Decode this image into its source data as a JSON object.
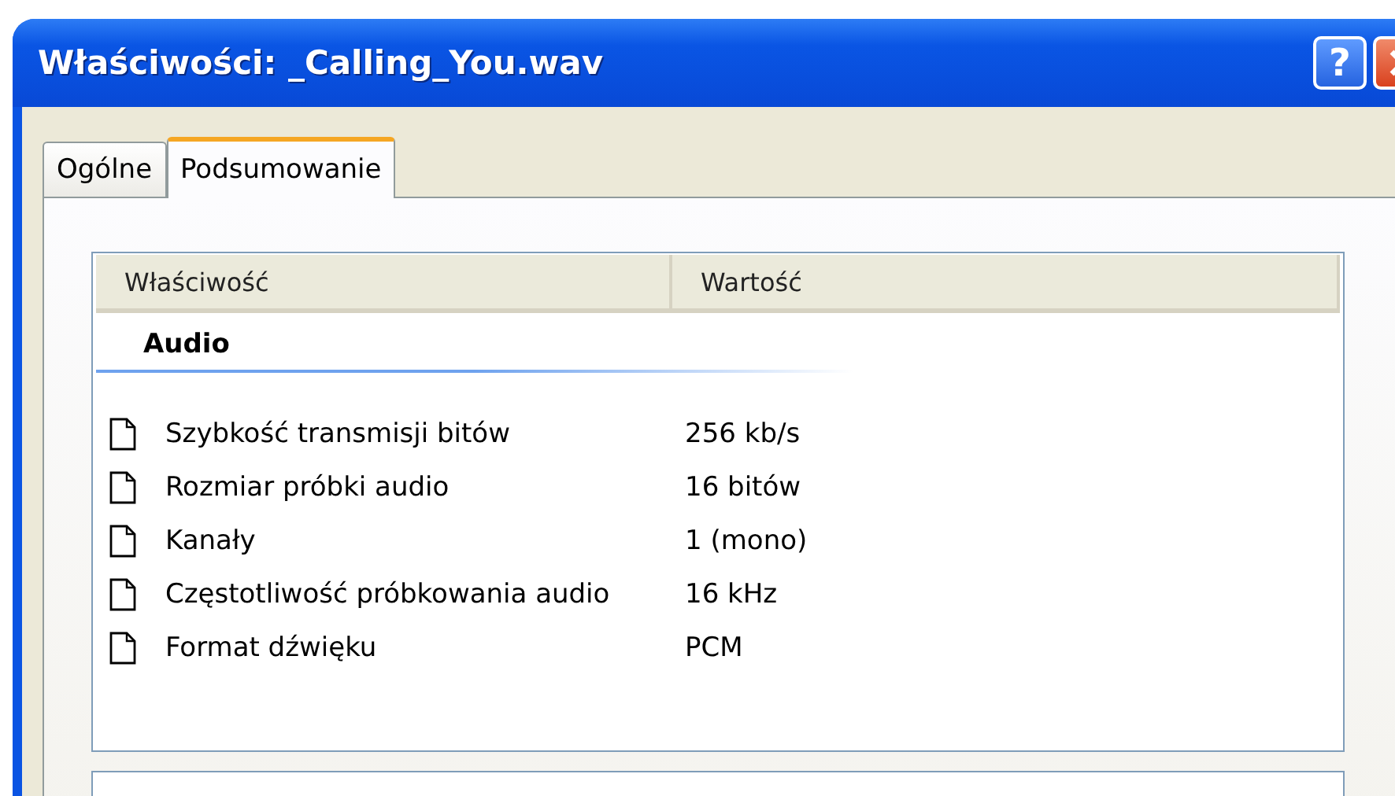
{
  "window": {
    "title": "Właściwości: _Calling_You.wav",
    "help_button": "?"
  },
  "tabs": [
    {
      "label": "Ogólne",
      "selected": false
    },
    {
      "label": "Podsumowanie",
      "selected": true
    }
  ],
  "table": {
    "columns": [
      "Właściwość",
      "Wartość"
    ],
    "group": "Audio",
    "rows": [
      {
        "name": "Szybkość transmisji bitów",
        "value": "256 kb/s"
      },
      {
        "name": "Rozmiar próbki audio",
        "value": "16 bitów"
      },
      {
        "name": "Kanały",
        "value": "1 (mono)"
      },
      {
        "name": "Częstotliwość próbkowania audio",
        "value": "16 kHz"
      },
      {
        "name": "Format dźwięku",
        "value": "PCM"
      }
    ]
  }
}
